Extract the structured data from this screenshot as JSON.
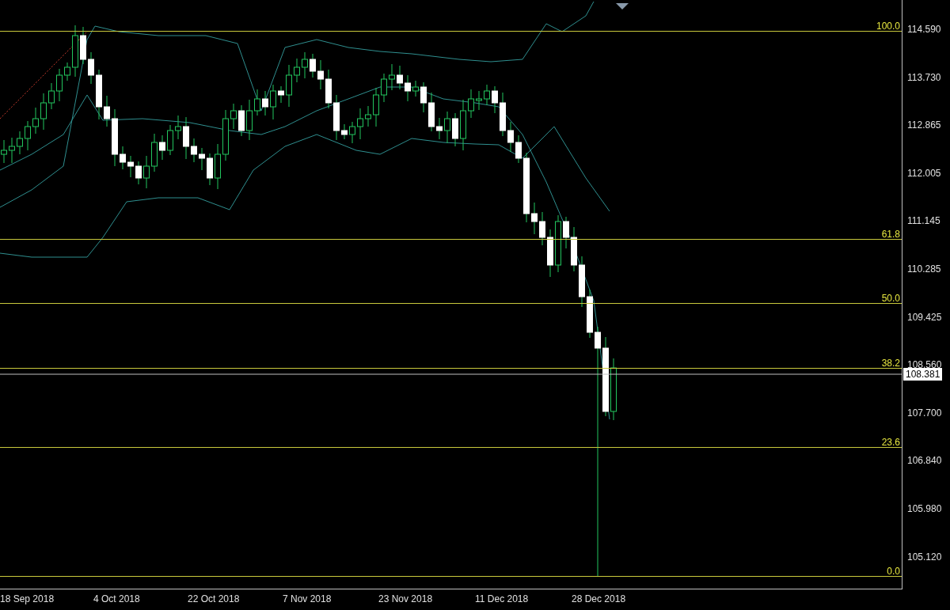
{
  "price_axis": {
    "labels": [
      "114.590",
      "113.730",
      "112.865",
      "112.005",
      "111.145",
      "110.285",
      "109.425",
      "108.560",
      "107.700",
      "106.840",
      "105.980",
      "105.120"
    ],
    "current_price": "108.381"
  },
  "fibonacci_levels": [
    {
      "label": "100.0"
    },
    {
      "label": "61.8"
    },
    {
      "label": "50.0"
    },
    {
      "label": "38.2"
    },
    {
      "label": "23.6"
    },
    {
      "label": "0.0"
    }
  ],
  "time_axis": {
    "labels": [
      "18 Sep 2018",
      "4 Oct 2018",
      "22 Oct 2018",
      "7 Nov 2018",
      "23 Nov 2018",
      "11 Dec 2018",
      "28 Dec 2018"
    ]
  }
}
